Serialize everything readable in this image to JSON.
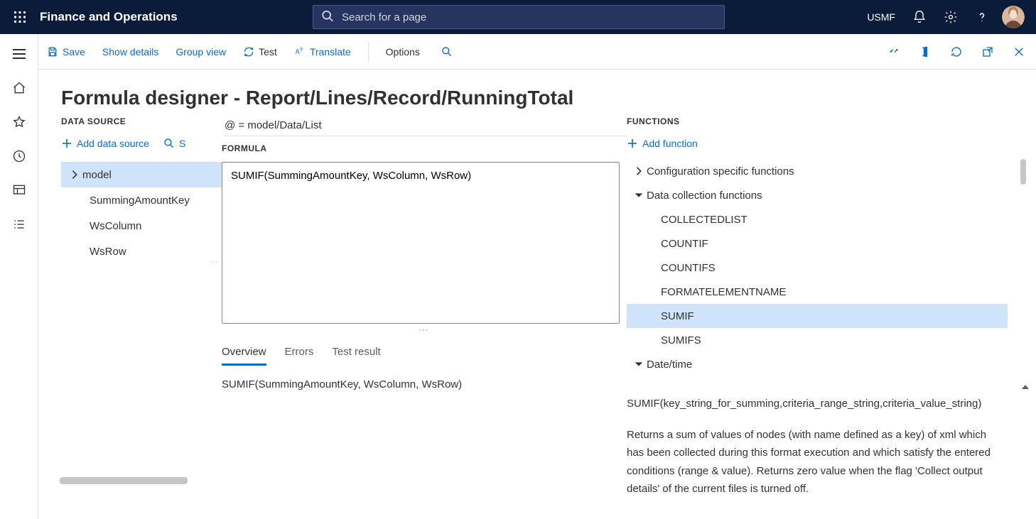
{
  "header": {
    "app_title": "Finance and Operations",
    "search_placeholder": "Search for a page",
    "company": "USMF"
  },
  "toolbar": {
    "save": "Save",
    "show_details": "Show details",
    "group_view": "Group view",
    "test": "Test",
    "translate": "Translate",
    "options": "Options"
  },
  "page": {
    "title": "Formula designer - Report/Lines/Record/RunningTotal"
  },
  "datasource": {
    "label": "DATA SOURCE",
    "add_label": "Add data source",
    "search_label": "S",
    "items": [
      "model",
      "SummingAmountKey",
      "WsColumn",
      "WsRow"
    ]
  },
  "formula": {
    "crumb": "@ = model/Data/List",
    "label": "FORMULA",
    "text": "SUMIF(SummingAmountKey, WsColumn, WsRow)",
    "tabs": {
      "overview": "Overview",
      "errors": "Errors",
      "test_result": "Test result"
    },
    "overview_text": "SUMIF(SummingAmountKey, WsColumn, WsRow)"
  },
  "functions": {
    "label": "FUNCTIONS",
    "add_label": "Add function",
    "groups": {
      "config": "Configuration specific functions",
      "data_collection": "Data collection functions",
      "datetime": "Date/time"
    },
    "data_collection_items": [
      "COLLECTEDLIST",
      "COUNTIF",
      "COUNTIFS",
      "FORMATELEMENTNAME",
      "SUMIF",
      "SUMIFS"
    ],
    "signature": "SUMIF(key_string_for_summing,criteria_range_string,criteria_value_string)",
    "description": "Returns a sum of values of nodes (with name defined as a key) of xml which has been collected during this format execution and which satisfy the entered conditions (range & value). Returns zero value when the flag 'Collect output details' of the current files is turned off."
  }
}
